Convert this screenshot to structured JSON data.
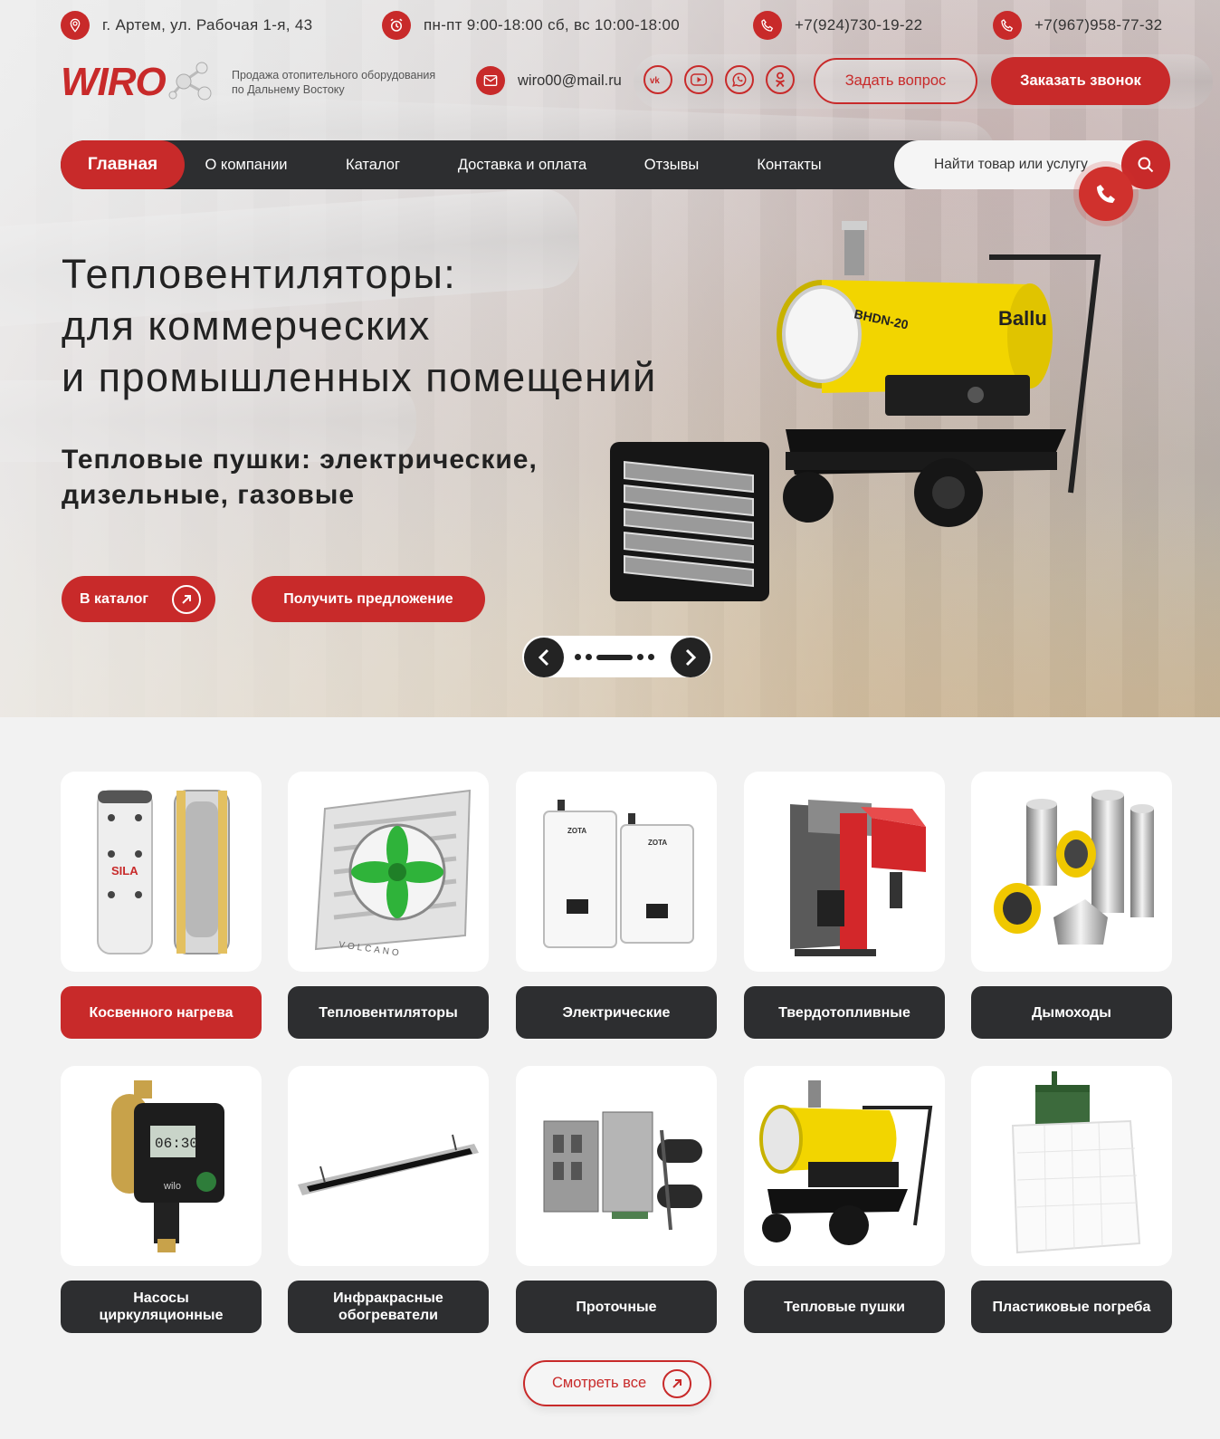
{
  "topbar": {
    "address": "г. Артем, ул. Рабочая 1-я, 43",
    "hours": "пн-пт 9:00-18:00 сб, вс 10:00-18:00",
    "phone1": "+7(924)730-19-22",
    "phone2": "+7(967)958-77-32"
  },
  "header": {
    "logo": "WIRO",
    "tagline_line1": "Продажа отопительного оборудования",
    "tagline_line2": "по Дальнему Востоку",
    "email": "wiro00@mail.ru",
    "socials": [
      "vk-icon",
      "youtube-icon",
      "whatsapp-icon",
      "odnoklassniki-icon"
    ],
    "ask_button": "Задать вопрос",
    "call_button": "Заказать звонок"
  },
  "nav": {
    "items": [
      "Главная",
      "О компании",
      "Каталог",
      "Доставка и оплата",
      "Отзывы",
      "Контакты"
    ],
    "search_placeholder": "Найти товар или услугу"
  },
  "hero": {
    "title_line1": "Тепловентиляторы:",
    "title_line2": "для коммерческих",
    "title_line3": "и промышленных помещений",
    "subtitle_line1": "Тепловые пушки: электрические,",
    "subtitle_line2": "дизельные, газовые",
    "catalog_button": "В каталог",
    "offer_button": "Получить предложение",
    "heater_model": "BHDN-20",
    "heater_brand": "Ballu"
  },
  "categories": [
    {
      "label": "Косвенного нагрева",
      "active": true
    },
    {
      "label": "Тепловентиляторы",
      "active": false
    },
    {
      "label": "Электрические",
      "active": false
    },
    {
      "label": "Твердотопливные",
      "active": false
    },
    {
      "label": "Дымоходы",
      "active": false
    },
    {
      "label": "Насосы циркуляционные",
      "active": false
    },
    {
      "label": "Инфракрасные обогреватели",
      "active": false
    },
    {
      "label": "Проточные",
      "active": false
    },
    {
      "label": "Тепловые пушки",
      "active": false
    },
    {
      "label": "Пластиковые погреба",
      "active": false
    }
  ],
  "product_text": {
    "sila": "SILA",
    "volcano": "VOLCANO",
    "zota": "ZOTA",
    "pump_time": "06:30",
    "pump_brand": "wilo"
  },
  "see_all": "Смотреть все",
  "colors": {
    "accent": "#c82a2a",
    "dark": "#2d2e30",
    "background": "#f2f2f2"
  }
}
